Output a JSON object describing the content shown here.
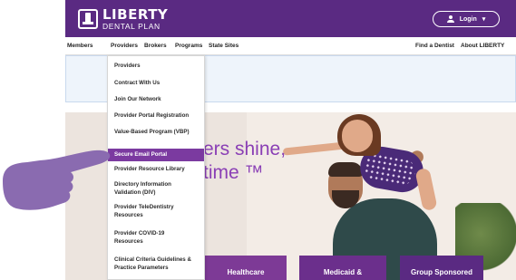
{
  "brand": {
    "name_line1": "LIBERTY",
    "name_line2": "DENTAL PLAN",
    "primary_color": "#5a2a82",
    "accent_color": "#7b3aa0"
  },
  "header": {
    "login_label": "Login"
  },
  "nav": {
    "items": [
      "Members",
      "Providers",
      "Brokers",
      "Programs",
      "State Sites"
    ],
    "right_items": [
      "Find a Dentist",
      "About LIBERTY"
    ]
  },
  "dropdown": {
    "items": [
      "Providers",
      "Contract With Us",
      "Join Our Network",
      "Provider Portal Registration",
      "Value-Based Program (VBP)",
      "Secure Email Portal",
      "Provider Resource Library",
      "Directory Information Validation (DIV)",
      "Provider TeleDentistry Resources",
      "Provider COVID-19 Resources",
      "Clinical Criteria Guidelines & Practice Parameters"
    ],
    "active_index": 5
  },
  "hero": {
    "line1": "ers shine,",
    "line2": "time ™"
  },
  "tiles": [
    "Healthcare",
    "Medicaid &",
    "Group Sponsored"
  ],
  "icons": {
    "pointer": "pointing-hand-icon",
    "user": "user-icon",
    "chevron": "chevron-down-icon"
  }
}
